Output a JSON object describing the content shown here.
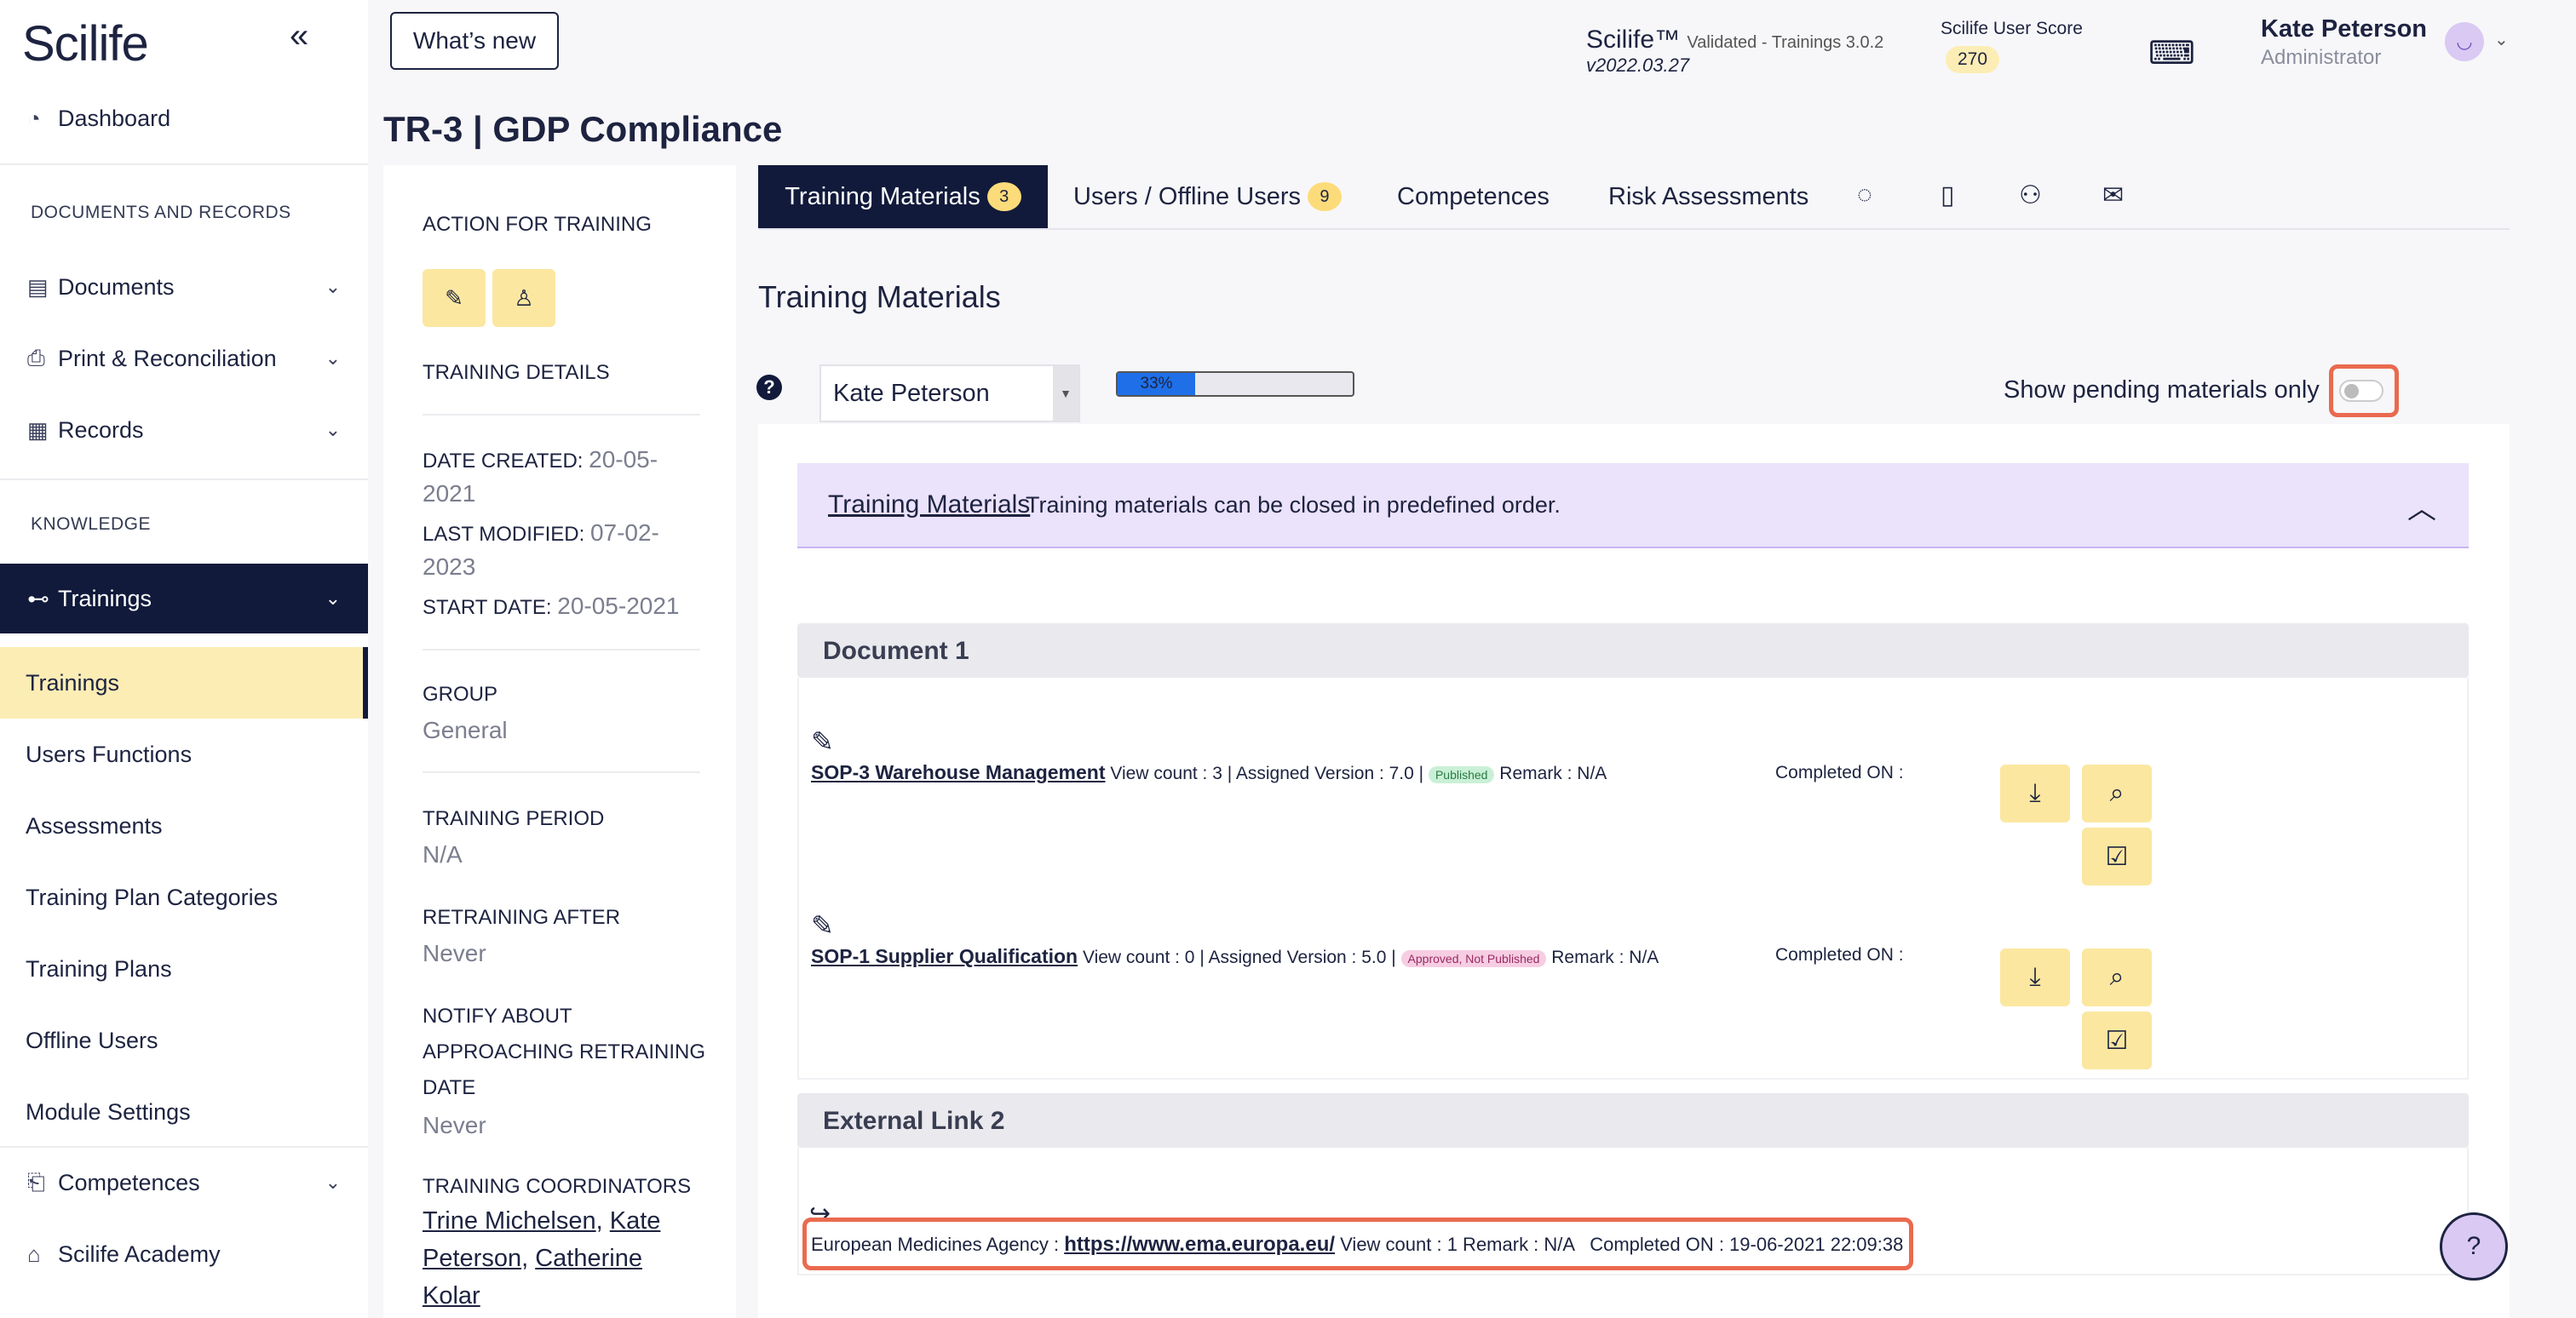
{
  "sidebar": {
    "logo": "Scilife",
    "dashboard": "Dashboard",
    "section_docs": "DOCUMENTS AND RECORDS",
    "documents": "Documents",
    "print_reconciliation": "Print & Reconciliation",
    "records": "Records",
    "section_knowledge": "KNOWLEDGE",
    "trainings_parent": "Trainings",
    "sub_items": [
      "Trainings",
      "Users Functions",
      "Assessments",
      "Training Plan Categories",
      "Training Plans",
      "Offline Users",
      "Module Settings"
    ],
    "competences": "Competences",
    "academy": "Scilife Academy"
  },
  "topbar": {
    "whats_new": "What’s new",
    "app_name": "Scilife™",
    "app_validated": "Validated - Trainings 3.0.2",
    "app_version": "v2022.03.27",
    "score_label": "Scilife User Score",
    "score_value": "270",
    "user_name": "Kate Peterson",
    "user_role": "Administrator"
  },
  "page": {
    "title": "TR-3 | GDP Compliance"
  },
  "details": {
    "action_label": "ACTION FOR TRAINING",
    "training_details": "TRAINING DETAILS",
    "date_created_label": "DATE CREATED:",
    "date_created_l1": "20-05-",
    "date_created_l2": "2021",
    "last_modified_label": "LAST MODIFIED:",
    "last_modified_l1": "07-02-",
    "last_modified_l2": "2023",
    "start_date_label": "START DATE:",
    "start_date": "20-05-2021",
    "group_label": "GROUP",
    "group_value": "General",
    "period_label": "TRAINING PERIOD",
    "period_value": "N/A",
    "retraining_label": "RETRAINING AFTER",
    "retraining_value": "Never",
    "notify_l1": "NOTIFY ABOUT",
    "notify_l2": "APPROACHING RETRAINING",
    "notify_l3": "DATE",
    "notify_value": "Never",
    "coordinators_label": "TRAINING COORDINATORS",
    "coord1": "Trine Michelsen",
    "coord2a": "Kate",
    "coord2b": "Peterson",
    "coord3a": "Catherine",
    "coord3b": "Kolar",
    "comma": ","
  },
  "tabs": [
    {
      "label": "Training Materials",
      "badge": "3"
    },
    {
      "label": "Users / Offline Users",
      "badge": "9"
    },
    {
      "label": "Competences"
    },
    {
      "label": "Risk Assessments"
    }
  ],
  "materials": {
    "heading": "Training Materials",
    "help": "?",
    "selected_user": "Kate Peterson",
    "progress_text": "33%",
    "progress_value": 0.33,
    "pending_label": "Show pending materials only",
    "pending_on": false,
    "info_title": "Training Materials",
    "info_text": "Training materials can be closed in predefined order.",
    "section1": "Document 1",
    "doc1_link": "SOP-3 Warehouse Management",
    "doc1_meta": "View count : 3 | Assigned Version : 7.0 |",
    "doc1_status": "Published",
    "doc1_remark": "Remark : N/A",
    "doc2_link": "SOP-1 Supplier Qualification",
    "doc2_meta": "View count : 0 | Assigned Version : 5.0 |",
    "doc2_status": "Approved, Not Published",
    "doc2_remark": "Remark : N/A",
    "completed_label": "Completed ON :",
    "section2": "External Link 2",
    "ext_name": "European Medicines Agency :",
    "ext_link": "https://www.ema.europa.eu/",
    "ext_meta": "View count : 1 Remark : N/A",
    "ext_completed": "Completed ON : 19-06-2021 22:09:38"
  },
  "colors": {
    "navy": "#111a3b",
    "yellow": "#fbe7a0",
    "highlight": "#ea6a4f",
    "lavender": "#ebe2fb"
  }
}
